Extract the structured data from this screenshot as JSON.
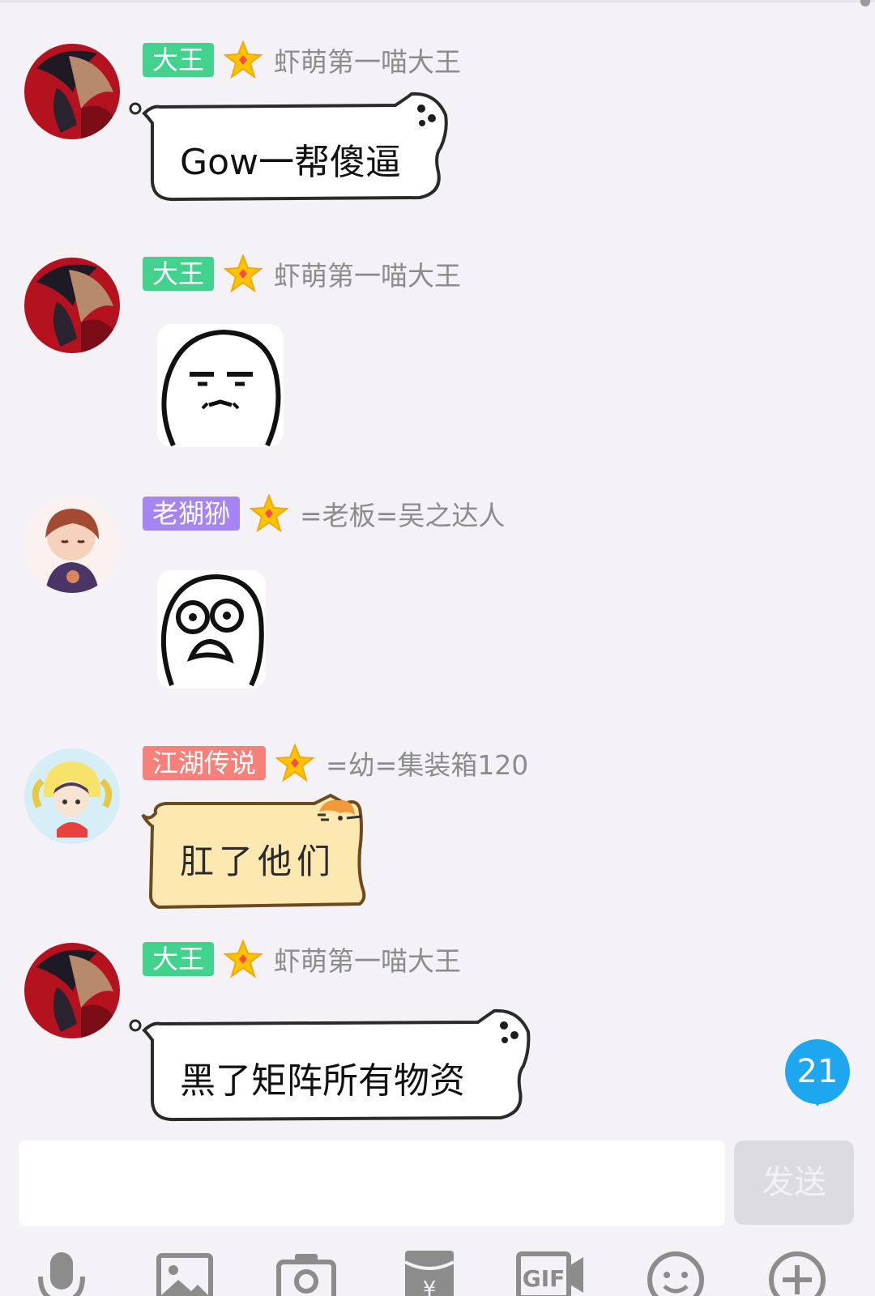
{
  "messages": [
    {
      "badge": "大王",
      "nickname": "虾萌第一喵大王",
      "text": "Gow一帮傻逼"
    },
    {
      "badge": "大王",
      "nickname": "虾萌第一喵大王"
    },
    {
      "badge": "老猢狲",
      "nickname": "=老板=吴之达人"
    },
    {
      "badge": "江湖传说",
      "nickname": "=幼=集装箱120",
      "text": "肛了他们"
    },
    {
      "badge": "大王",
      "nickname": "虾萌第一喵大王",
      "text": "黑了矩阵所有物资"
    }
  ],
  "unread_count": "21",
  "composer": {
    "input_value": "",
    "send_label": "发送"
  },
  "toolbar_icons": [
    "microphone-icon",
    "image-icon",
    "camera-icon",
    "red-envelope-icon",
    "gif-icon",
    "emoji-icon",
    "plus-icon"
  ],
  "colors": {
    "badge_green": "#43d18e",
    "badge_purple": "#a685f2",
    "badge_salmon": "#f5817a",
    "unread_blue": "#1ea7ef",
    "background": "#f4f1f7"
  }
}
